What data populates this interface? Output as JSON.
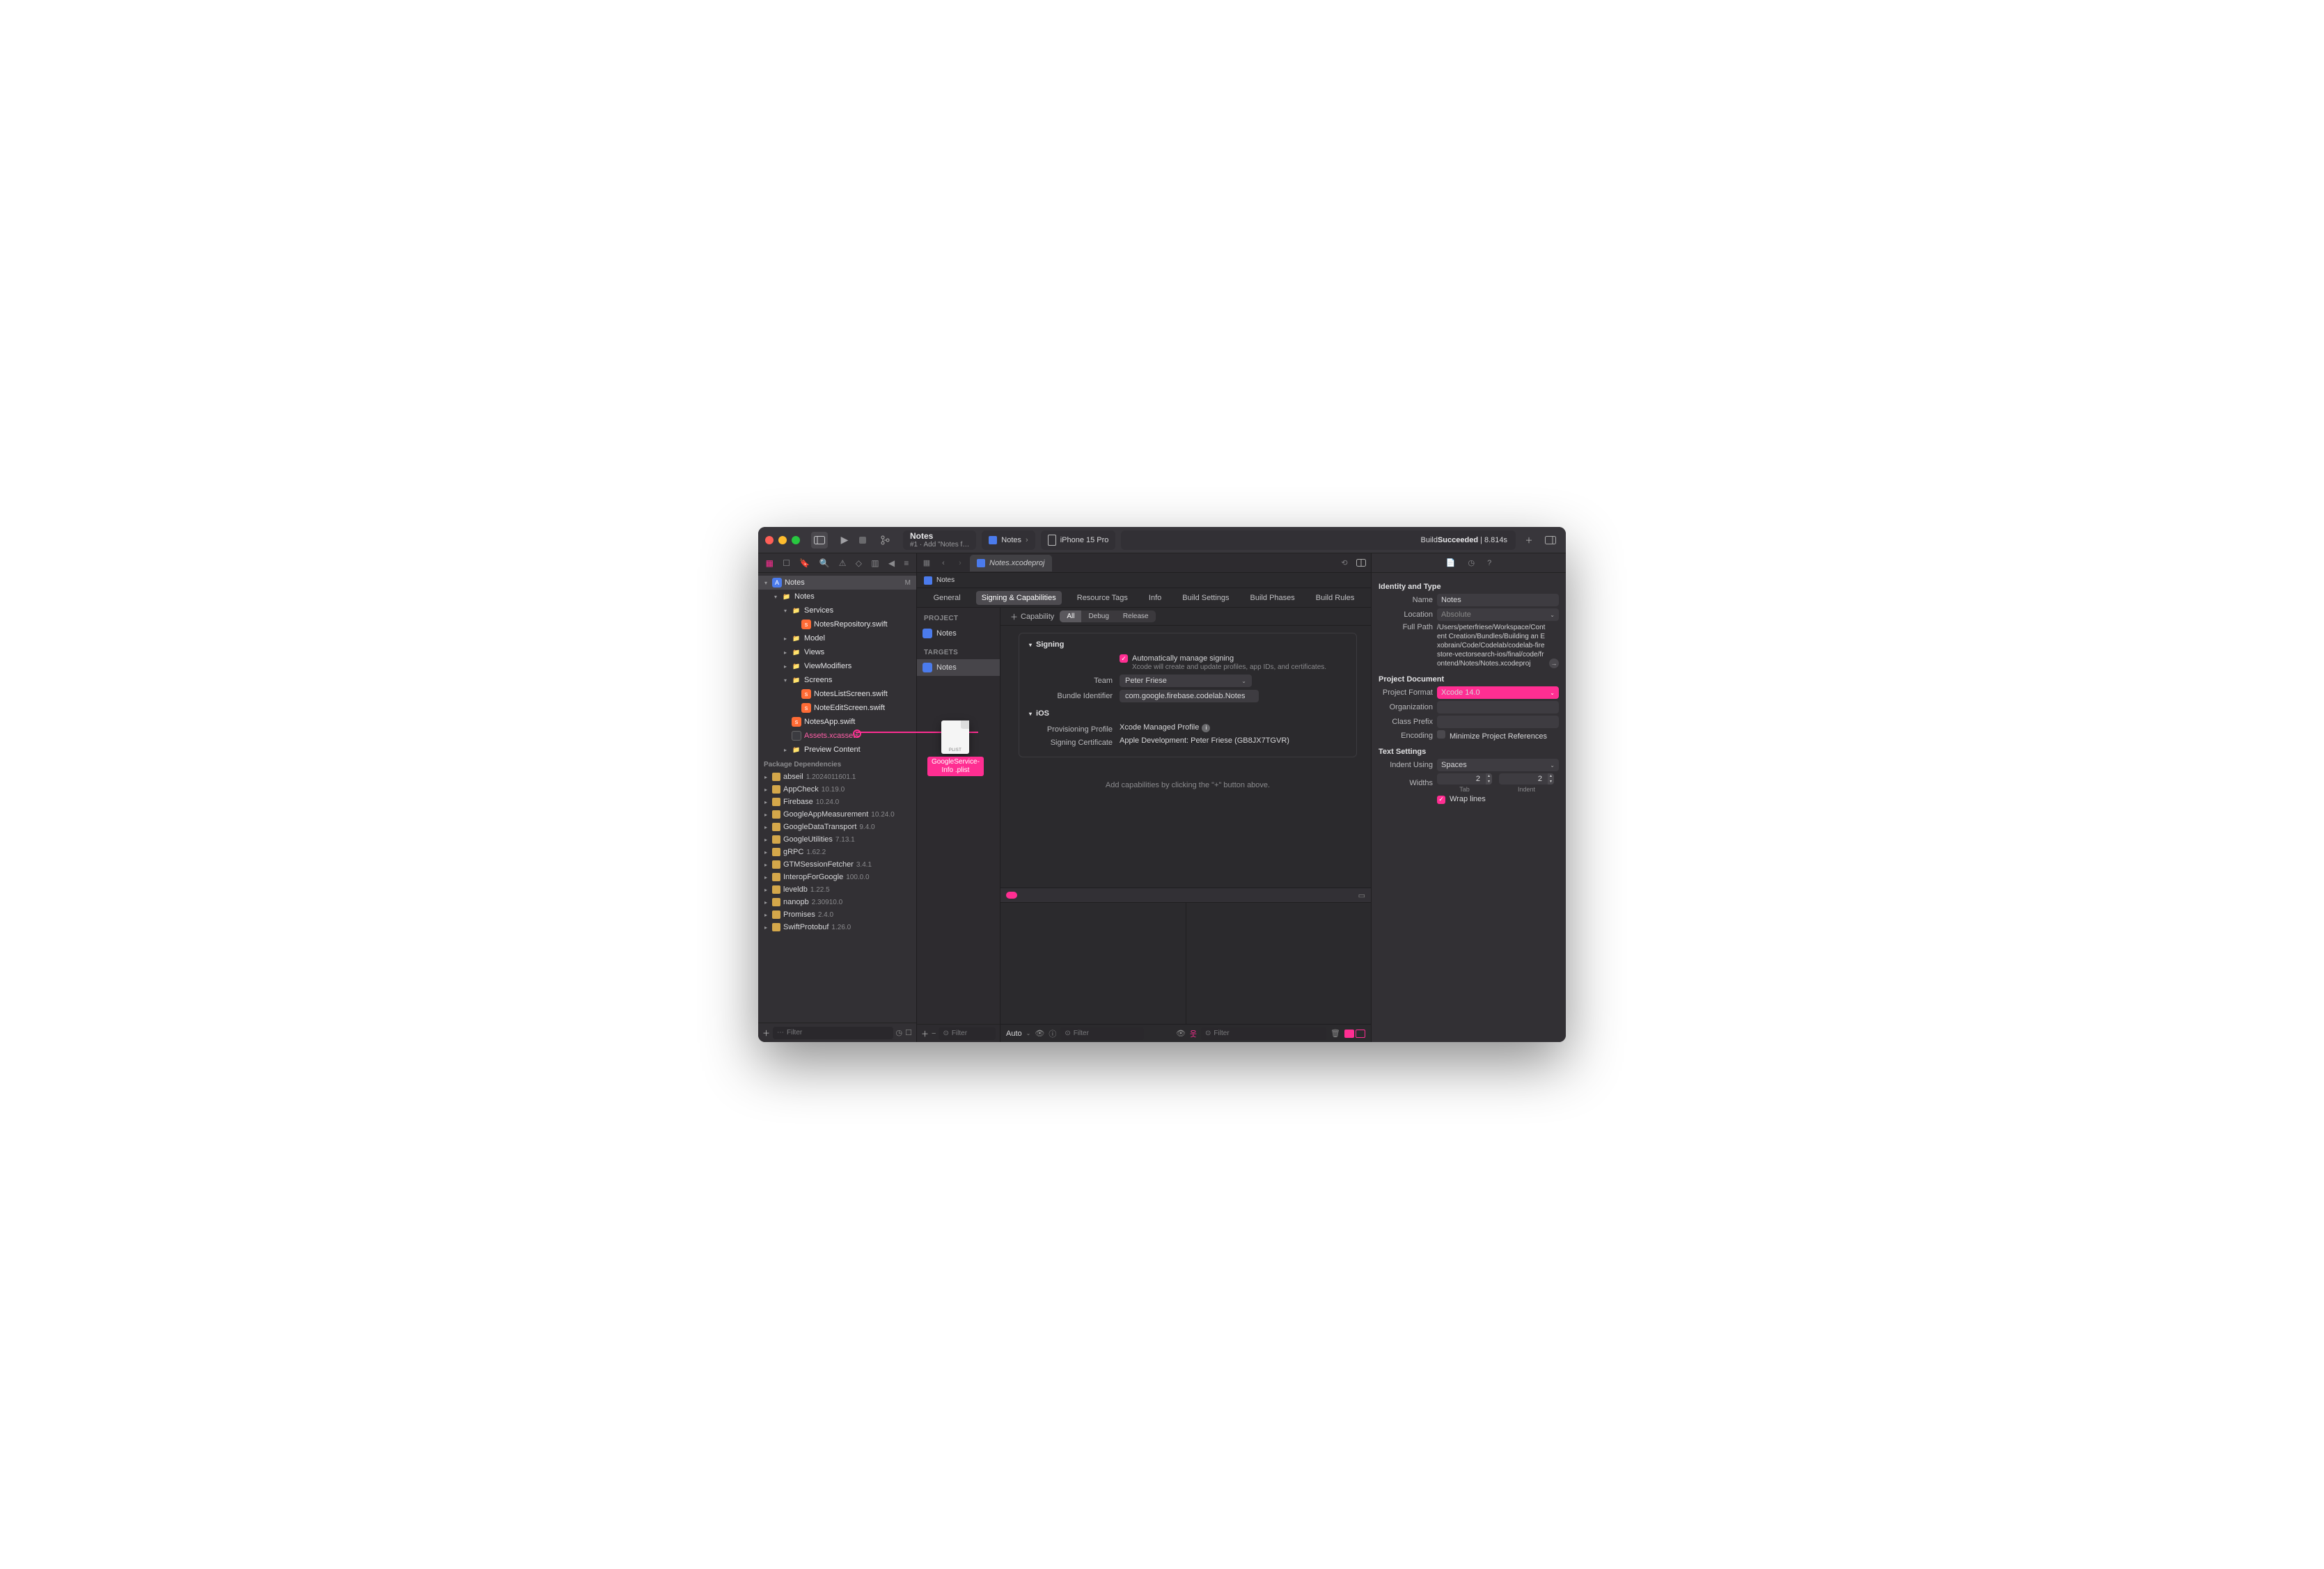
{
  "toolbar": {
    "scheme_title": "Notes",
    "scheme_sub": "#1 · Add \"Notes f…",
    "scheme_pop": "Notes",
    "device": "iPhone 15 Pro",
    "status_prefix": "Build ",
    "status_result": "Succeeded",
    "status_time": " | 8.814s"
  },
  "tabs": {
    "active": "Notes.xcodeproj"
  },
  "jump": {
    "project": "Notes"
  },
  "navigator": {
    "root": "Notes",
    "root_status": "M",
    "group_notes": "Notes",
    "services": "Services",
    "repo": "NotesRepository.swift",
    "model": "Model",
    "views": "Views",
    "viewmods": "ViewModifiers",
    "screens": "Screens",
    "listscreen": "NotesListScreen.swift",
    "editscreen": "NoteEditScreen.swift",
    "app": "NotesApp.swift",
    "assets": "Assets.xcassets",
    "preview": "Preview Content",
    "pkg_header": "Package Dependencies",
    "packages": [
      {
        "n": "abseil",
        "v": "1.2024011601.1"
      },
      {
        "n": "AppCheck",
        "v": "10.19.0"
      },
      {
        "n": "Firebase",
        "v": "10.24.0"
      },
      {
        "n": "GoogleAppMeasurement",
        "v": "10.24.0"
      },
      {
        "n": "GoogleDataTransport",
        "v": "9.4.0"
      },
      {
        "n": "GoogleUtilities",
        "v": "7.13.1"
      },
      {
        "n": "gRPC",
        "v": "1.62.2"
      },
      {
        "n": "GTMSessionFetcher",
        "v": "3.4.1"
      },
      {
        "n": "InteropForGoogle",
        "v": "100.0.0"
      },
      {
        "n": "leveldb",
        "v": "1.22.5"
      },
      {
        "n": "nanopb",
        "v": "2.30910.0"
      },
      {
        "n": "Promises",
        "v": "2.4.0"
      },
      {
        "n": "SwiftProtobuf",
        "v": "1.26.0"
      }
    ],
    "filter_placeholder": "Filter"
  },
  "drag": {
    "ext": "PLIST",
    "label1": "GoogleService-",
    "label2": "Info .plist"
  },
  "targets": {
    "project_hdr": "PROJECT",
    "project": "Notes",
    "targets_hdr": "TARGETS",
    "target": "Notes",
    "filter_placeholder": "Filter"
  },
  "seg": {
    "general": "General",
    "signing": "Signing & Capabilities",
    "resource": "Resource Tags",
    "info": "Info",
    "build_settings": "Build Settings",
    "build_phases": "Build Phases",
    "build_rules": "Build Rules"
  },
  "capbar": {
    "add": "Capability",
    "all": "All",
    "debug": "Debug",
    "release": "Release"
  },
  "signing": {
    "title": "Signing",
    "auto_label": "Automatically manage signing",
    "auto_hint": "Xcode will create and update profiles, app IDs, and certificates.",
    "team_k": "Team",
    "team_v": "Peter Friese",
    "bundle_k": "Bundle Identifier",
    "bundle_v": "com.google.firebase.codelab.Notes",
    "ios_title": "iOS",
    "prov_k": "Provisioning Profile",
    "prov_v": "Xcode Managed Profile",
    "cert_k": "Signing Certificate",
    "cert_v": "Apple Development: Peter Friese (GB8JX7TGVR)",
    "hint": "Add capabilities by clicking the \"+\" button above."
  },
  "debugbar": {
    "auto": "Auto",
    "filter_placeholder": "Filter"
  },
  "inspector": {
    "identity_hdr": "Identity and Type",
    "name_k": "Name",
    "name_v": "Notes",
    "location_k": "Location",
    "location_v": "Absolute",
    "fullpath_k": "Full Path",
    "fullpath_v": "/Users/peterfriese/Workspace/Content Creation/Bundles/Building an Exobrain/Code/Codelab/codelab-firestore-vectorsearch-ios/final/code/frontend/Notes/Notes.xcodeproj",
    "projdoc_hdr": "Project Document",
    "format_k": "Project Format",
    "format_v": "Xcode 14.0",
    "org_k": "Organization",
    "prefix_k": "Class Prefix",
    "encoding_k": "Encoding",
    "encoding_v": "Minimize Project References",
    "text_hdr": "Text Settings",
    "indent_k": "Indent Using",
    "indent_v": "Spaces",
    "widths_k": "Widths",
    "tab_v": "2",
    "tab_l": "Tab",
    "indent_v2": "2",
    "indent_l": "Indent",
    "wrap": "Wrap lines"
  }
}
